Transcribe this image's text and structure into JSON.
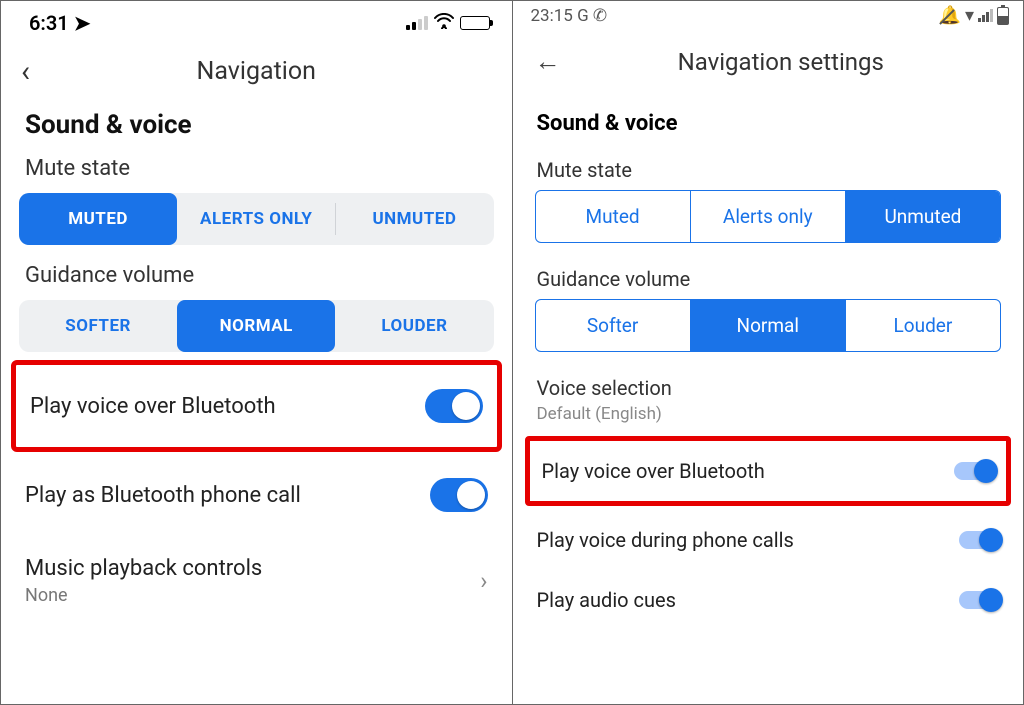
{
  "ios": {
    "status": {
      "time": "6:31",
      "location_icon": "location-arrow"
    },
    "header": {
      "title": "Navigation"
    },
    "section": "Sound & voice",
    "mute": {
      "label": "Mute state",
      "options": [
        "MUTED",
        "ALERTS ONLY",
        "UNMUTED"
      ],
      "selected": 0
    },
    "guidance": {
      "label": "Guidance volume",
      "options": [
        "SOFTER",
        "NORMAL",
        "LOUDER"
      ],
      "selected": 1
    },
    "rows": {
      "bluetooth": {
        "label": "Play voice over Bluetooth",
        "on": true,
        "highlighted": true
      },
      "phonecall": {
        "label": "Play as Bluetooth phone call",
        "on": true
      },
      "music": {
        "label": "Music playback controls",
        "value": "None"
      }
    }
  },
  "android": {
    "status": {
      "time": "23:15"
    },
    "header": {
      "title": "Navigation settings"
    },
    "section": "Sound & voice",
    "mute": {
      "label": "Mute state",
      "options": [
        "Muted",
        "Alerts only",
        "Unmuted"
      ],
      "selected": 2
    },
    "guidance": {
      "label": "Guidance volume",
      "options": [
        "Softer",
        "Normal",
        "Louder"
      ],
      "selected": 1
    },
    "voice": {
      "label": "Voice selection",
      "value": "Default (English)"
    },
    "rows": {
      "bluetooth": {
        "label": "Play voice over Bluetooth",
        "on": true,
        "highlighted": true
      },
      "duringcall": {
        "label": "Play voice during phone calls",
        "on": true
      },
      "cues": {
        "label": "Play audio cues",
        "on": true
      }
    }
  }
}
